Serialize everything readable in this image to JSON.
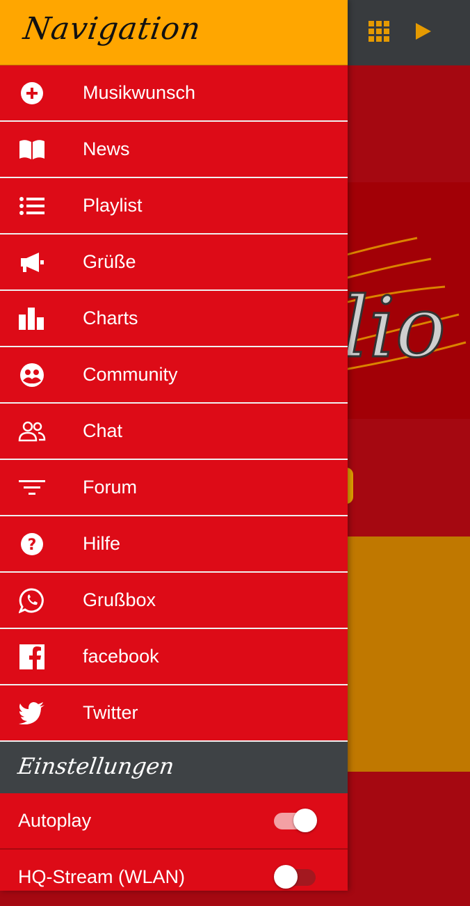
{
  "drawer": {
    "title": "Navigation",
    "items": [
      {
        "label": "Musikwunsch",
        "icon": "plus-circle-icon"
      },
      {
        "label": "News",
        "icon": "book-icon"
      },
      {
        "label": "Playlist",
        "icon": "list-icon"
      },
      {
        "label": "Grüße",
        "icon": "megaphone-icon"
      },
      {
        "label": "Charts",
        "icon": "bar-chart-icon"
      },
      {
        "label": "Community",
        "icon": "community-icon"
      },
      {
        "label": "Chat",
        "icon": "people-icon"
      },
      {
        "label": "Forum",
        "icon": "filter-icon"
      },
      {
        "label": "Hilfe",
        "icon": "help-icon"
      },
      {
        "label": "Grußbox",
        "icon": "whatsapp-icon"
      },
      {
        "label": "facebook",
        "icon": "facebook-icon"
      },
      {
        "label": "Twitter",
        "icon": "twitter-icon"
      }
    ],
    "settings_title": "Einstellungen",
    "settings": [
      {
        "label": "Autoplay",
        "enabled": true
      },
      {
        "label": "HQ-Stream (WLAN)",
        "enabled": false
      }
    ]
  },
  "background": {
    "icons": [
      "grid-icon",
      "play-icon"
    ],
    "logo_text": "lio"
  },
  "colors": {
    "drawer_red": "#dd0b17",
    "header_orange": "#ffa600",
    "settings_header": "#3e4245",
    "topbar": "#383b3e",
    "accent_orange": "#e59a00"
  }
}
